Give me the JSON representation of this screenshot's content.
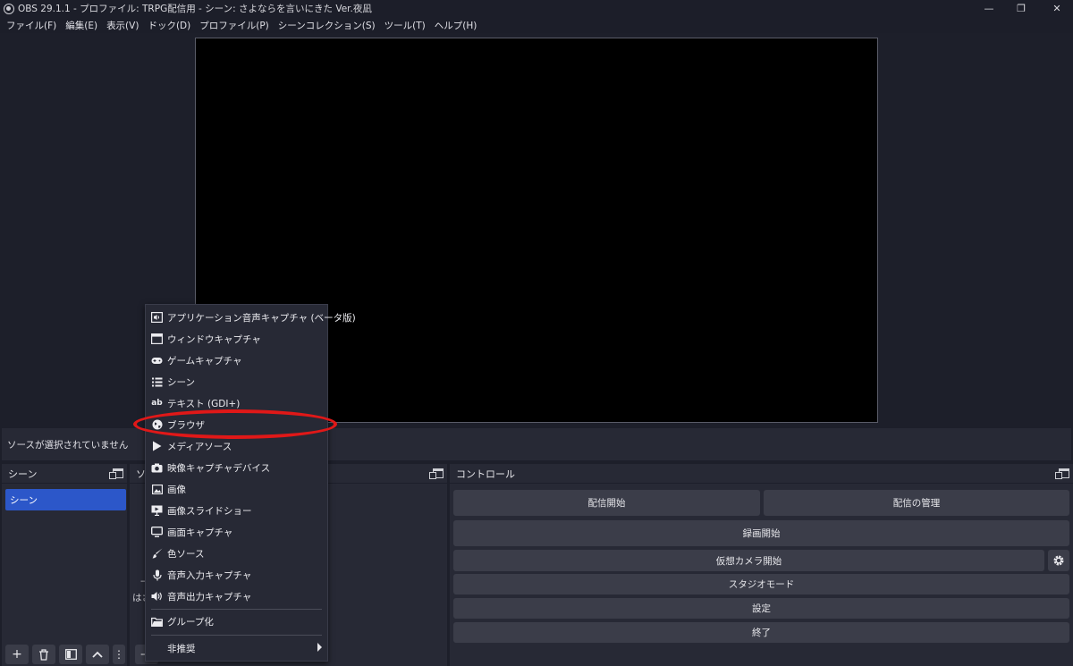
{
  "window": {
    "title": "OBS 29.1.1 - プロファイル: TRPG配信用 - シーン: さよならを言いにきた Ver.夜凪",
    "minimize": "—",
    "restore": "❐",
    "close": "✕"
  },
  "menubar": {
    "items": [
      "ファイル(F)",
      "編集(E)",
      "表示(V)",
      "ドック(D)",
      "プロファイル(P)",
      "シーンコレクション(S)",
      "ツール(T)",
      "ヘルプ(H)"
    ]
  },
  "source_bar": {
    "text": "ソースが選択されていません"
  },
  "scenes_dock": {
    "title": "シーン",
    "items": [
      "シーン"
    ],
    "toolbar": [
      "+",
      "🗑",
      "▮",
      "︿",
      "⋮"
    ]
  },
  "sources_dock": {
    "title": "ソ",
    "partial_text_1": "—",
    "partial_text_2": "はさ",
    "toolbar": [
      "—"
    ]
  },
  "controls_dock": {
    "title": "コントロール",
    "buttons": {
      "start_streaming": "配信開始",
      "manage_broadcast": "配信の管理",
      "start_recording": "録画開始",
      "start_virtual_camera": "仮想カメラ開始",
      "studio_mode": "スタジオモード",
      "settings": "設定",
      "exit": "終了"
    }
  },
  "context_menu": {
    "items": [
      {
        "label": "アプリケーション音声キャプチャ (ベータ版)",
        "icon": "speaker-icon"
      },
      {
        "label": "ウィンドウキャプチャ",
        "icon": "window-icon"
      },
      {
        "label": "ゲームキャプチャ",
        "icon": "gamepad-icon"
      },
      {
        "label": "シーン",
        "icon": "list-icon"
      },
      {
        "label": "テキスト (GDI+)",
        "icon": "text-icon"
      },
      {
        "label": "ブラウザ",
        "icon": "globe-icon"
      },
      {
        "label": "メディアソース",
        "icon": "play-icon"
      },
      {
        "label": "映像キャプチャデバイス",
        "icon": "camera-icon"
      },
      {
        "label": "画像",
        "icon": "image-icon"
      },
      {
        "label": "画像スライドショー",
        "icon": "slideshow-icon"
      },
      {
        "label": "画面キャプチャ",
        "icon": "monitor-icon"
      },
      {
        "label": "色ソース",
        "icon": "brush-icon"
      },
      {
        "label": "音声入力キャプチャ",
        "icon": "microphone-icon"
      },
      {
        "label": "音声出力キャプチャ",
        "icon": "speaker-icon"
      }
    ],
    "group": {
      "label": "グループ化",
      "icon": "folder-icon"
    },
    "deprecated": {
      "label": "非推奨"
    },
    "text_icon_glyph": "ab"
  },
  "colors": {
    "background": "#1d1f2a",
    "panel": "#272935",
    "button": "#3b3d49",
    "selection": "#2c57c9",
    "highlight_annotation": "#e01818"
  }
}
